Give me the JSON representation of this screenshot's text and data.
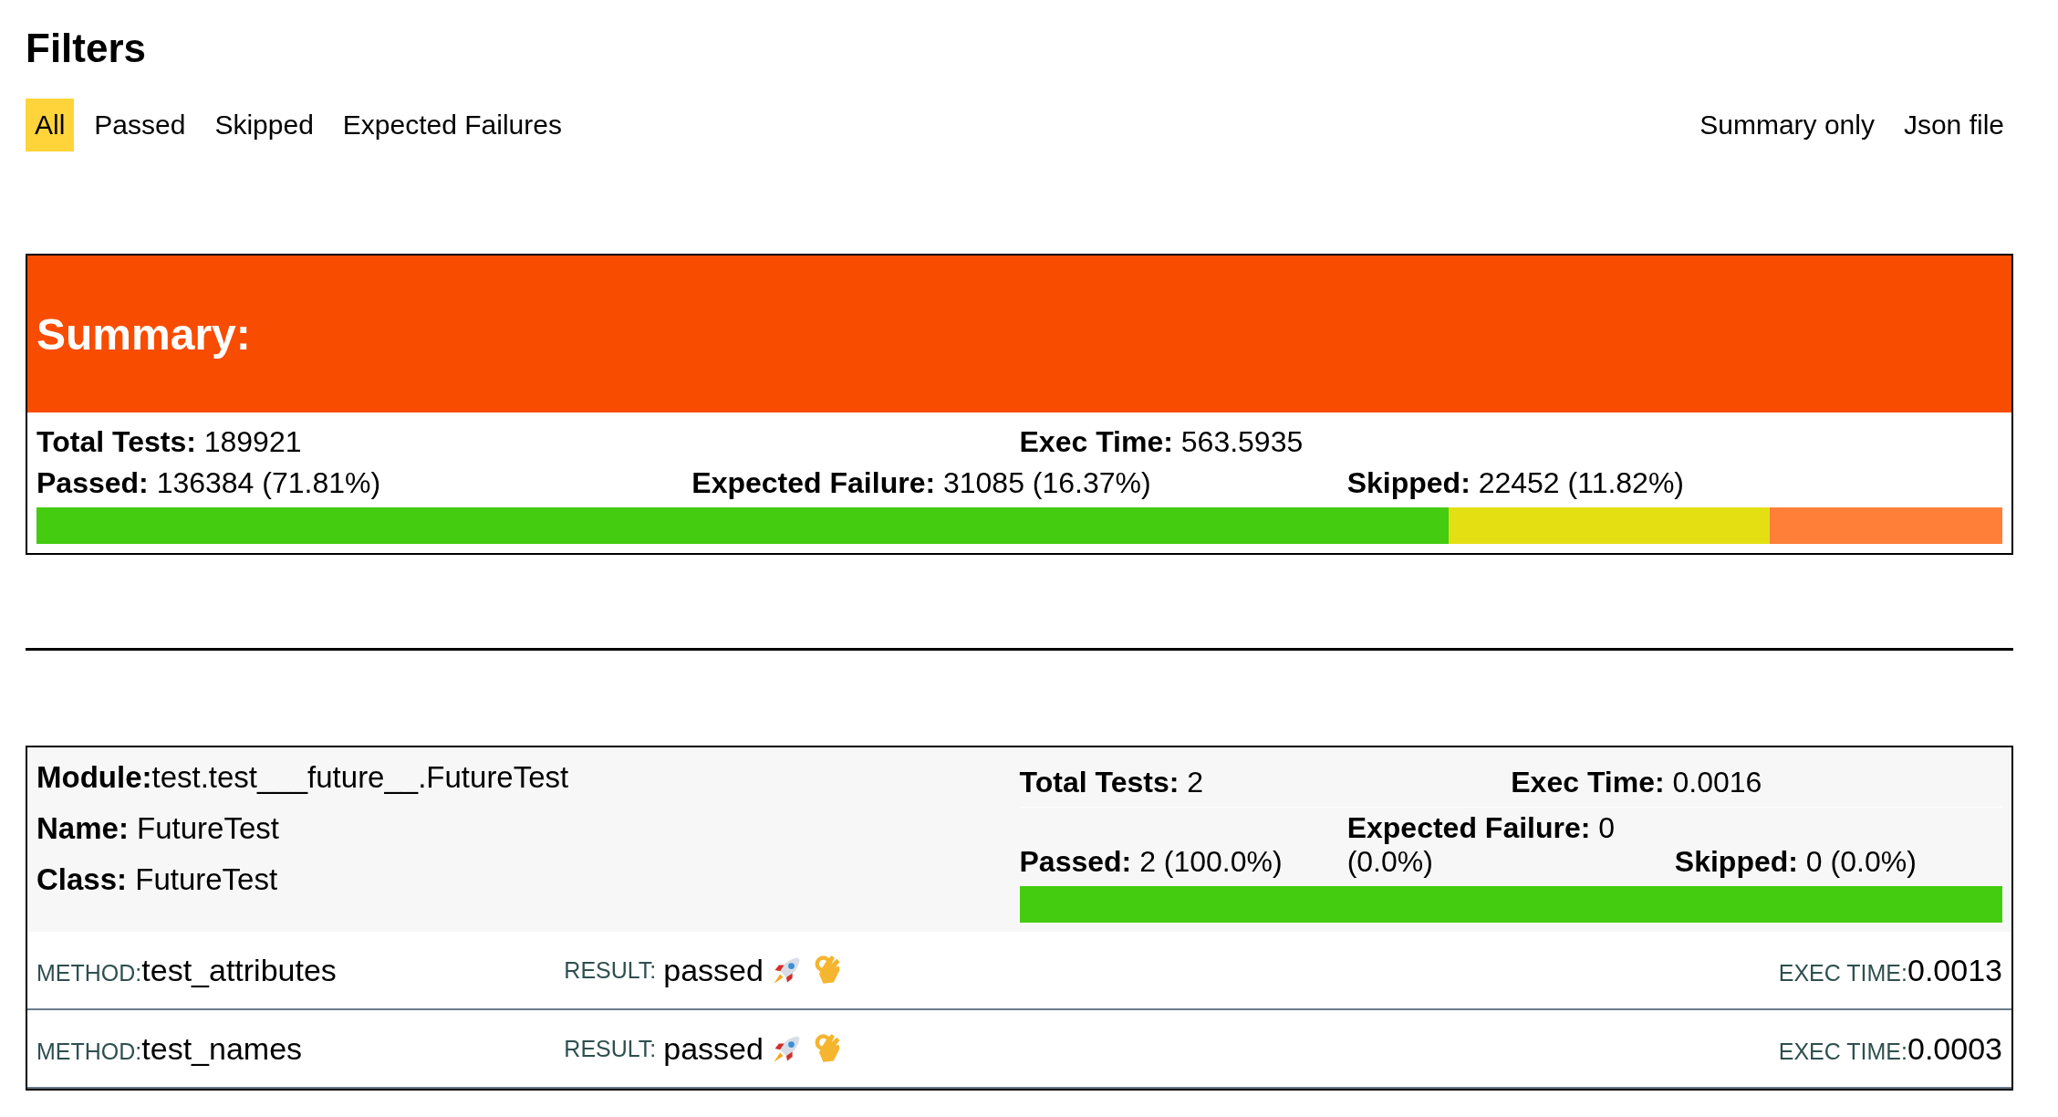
{
  "filters": {
    "title": "Filters",
    "tabs": [
      {
        "label": "All",
        "selected": true
      },
      {
        "label": "Passed",
        "selected": false
      },
      {
        "label": "Skipped",
        "selected": false
      },
      {
        "label": "Expected Failures",
        "selected": false
      }
    ],
    "links": [
      "Summary only",
      "Json file"
    ]
  },
  "summary": {
    "title": "Summary:",
    "total": "**Total Tests:** 189921",
    "exec": "**Exec Time:** 563.5935",
    "stats": [
      {
        "text": "**Passed:** 136384 (71.81%)"
      },
      {
        "text": "**Expected Failure:** 31085 (16.37%)"
      },
      {
        "text": "**Skipped:** 22452 (11.82%)"
      }
    ]
  },
  "modules": [
    {
      "module": "**Module:**test.test___future__.FutureTest",
      "name": "**Name:** FutureTest",
      "class": "**Class:** FutureTest",
      "total": "**Total Tests:** 2",
      "exec": "**Exec Time:** 0.0016",
      "stats": [
        {
          "text": "**Passed:** 2 (100.0%)"
        },
        {
          "text": "**Expected Failure:** 0 (0.0%)"
        },
        {
          "text": "**Skipped:** 0 (0.0%)"
        }
      ],
      "methods": [
        {
          "method_label": "METHOD:",
          "method": "test_attributes",
          "result_label": "RESULT:",
          "result": "passed",
          "exec_label": "EXEC TIME:",
          "exec": "0.0013"
        },
        {
          "method_label": "METHOD:",
          "method": "test_names",
          "result_label": "RESULT:",
          "result": "passed",
          "exec_label": "EXEC TIME:",
          "exec": "0.0003"
        }
      ]
    }
  ]
}
